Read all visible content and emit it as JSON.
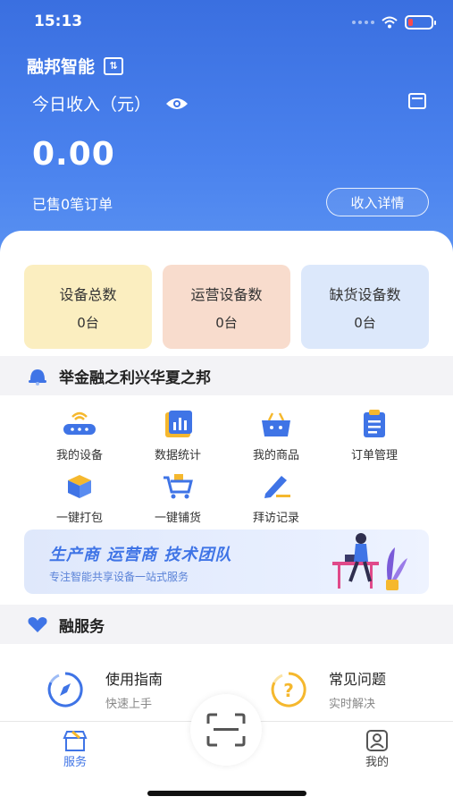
{
  "status_bar": {
    "time": "15:13"
  },
  "header": {
    "brand": "融邦智能",
    "switch_icon_text": "⇅",
    "income_label": "今日收入（元）",
    "income_amount": "0.00",
    "sold_text": "已售0笔订单",
    "detail_button": "收入详情"
  },
  "stats": [
    {
      "label": "设备总数",
      "value": "0台",
      "color": "#fbeec0"
    },
    {
      "label": "运营设备数",
      "value": "0台",
      "color": "#f8dccd"
    },
    {
      "label": "缺货设备数",
      "value": "0台",
      "color": "#dce8fb"
    }
  ],
  "slogan": "举金融之利兴华夏之邦",
  "grid": [
    {
      "label": "我的设备",
      "icon": "router-icon"
    },
    {
      "label": "数据统计",
      "icon": "chart-icon"
    },
    {
      "label": "我的商品",
      "icon": "basket-icon"
    },
    {
      "label": "订单管理",
      "icon": "clipboard-icon"
    },
    {
      "label": "一键打包",
      "icon": "box-icon"
    },
    {
      "label": "一键铺货",
      "icon": "cart-icon"
    },
    {
      "label": "拜访记录",
      "icon": "pen-icon"
    }
  ],
  "banner": {
    "title": "生产商  运营商  技术团队",
    "subtitle": "专注智能共享设备一站式服务"
  },
  "service_section": "融服务",
  "guides": [
    {
      "title": "使用指南",
      "subtitle": "快速上手",
      "icon": "compass-icon"
    },
    {
      "title": "常见问题",
      "subtitle": "实时解决",
      "icon": "question-icon"
    }
  ],
  "tabs": [
    {
      "label": "服务",
      "icon": "shop-icon",
      "active": true
    },
    {
      "label": "我的",
      "icon": "profile-icon",
      "active": false
    }
  ],
  "colors": {
    "primary": "#3f74e6",
    "accent": "#f5b82e"
  }
}
